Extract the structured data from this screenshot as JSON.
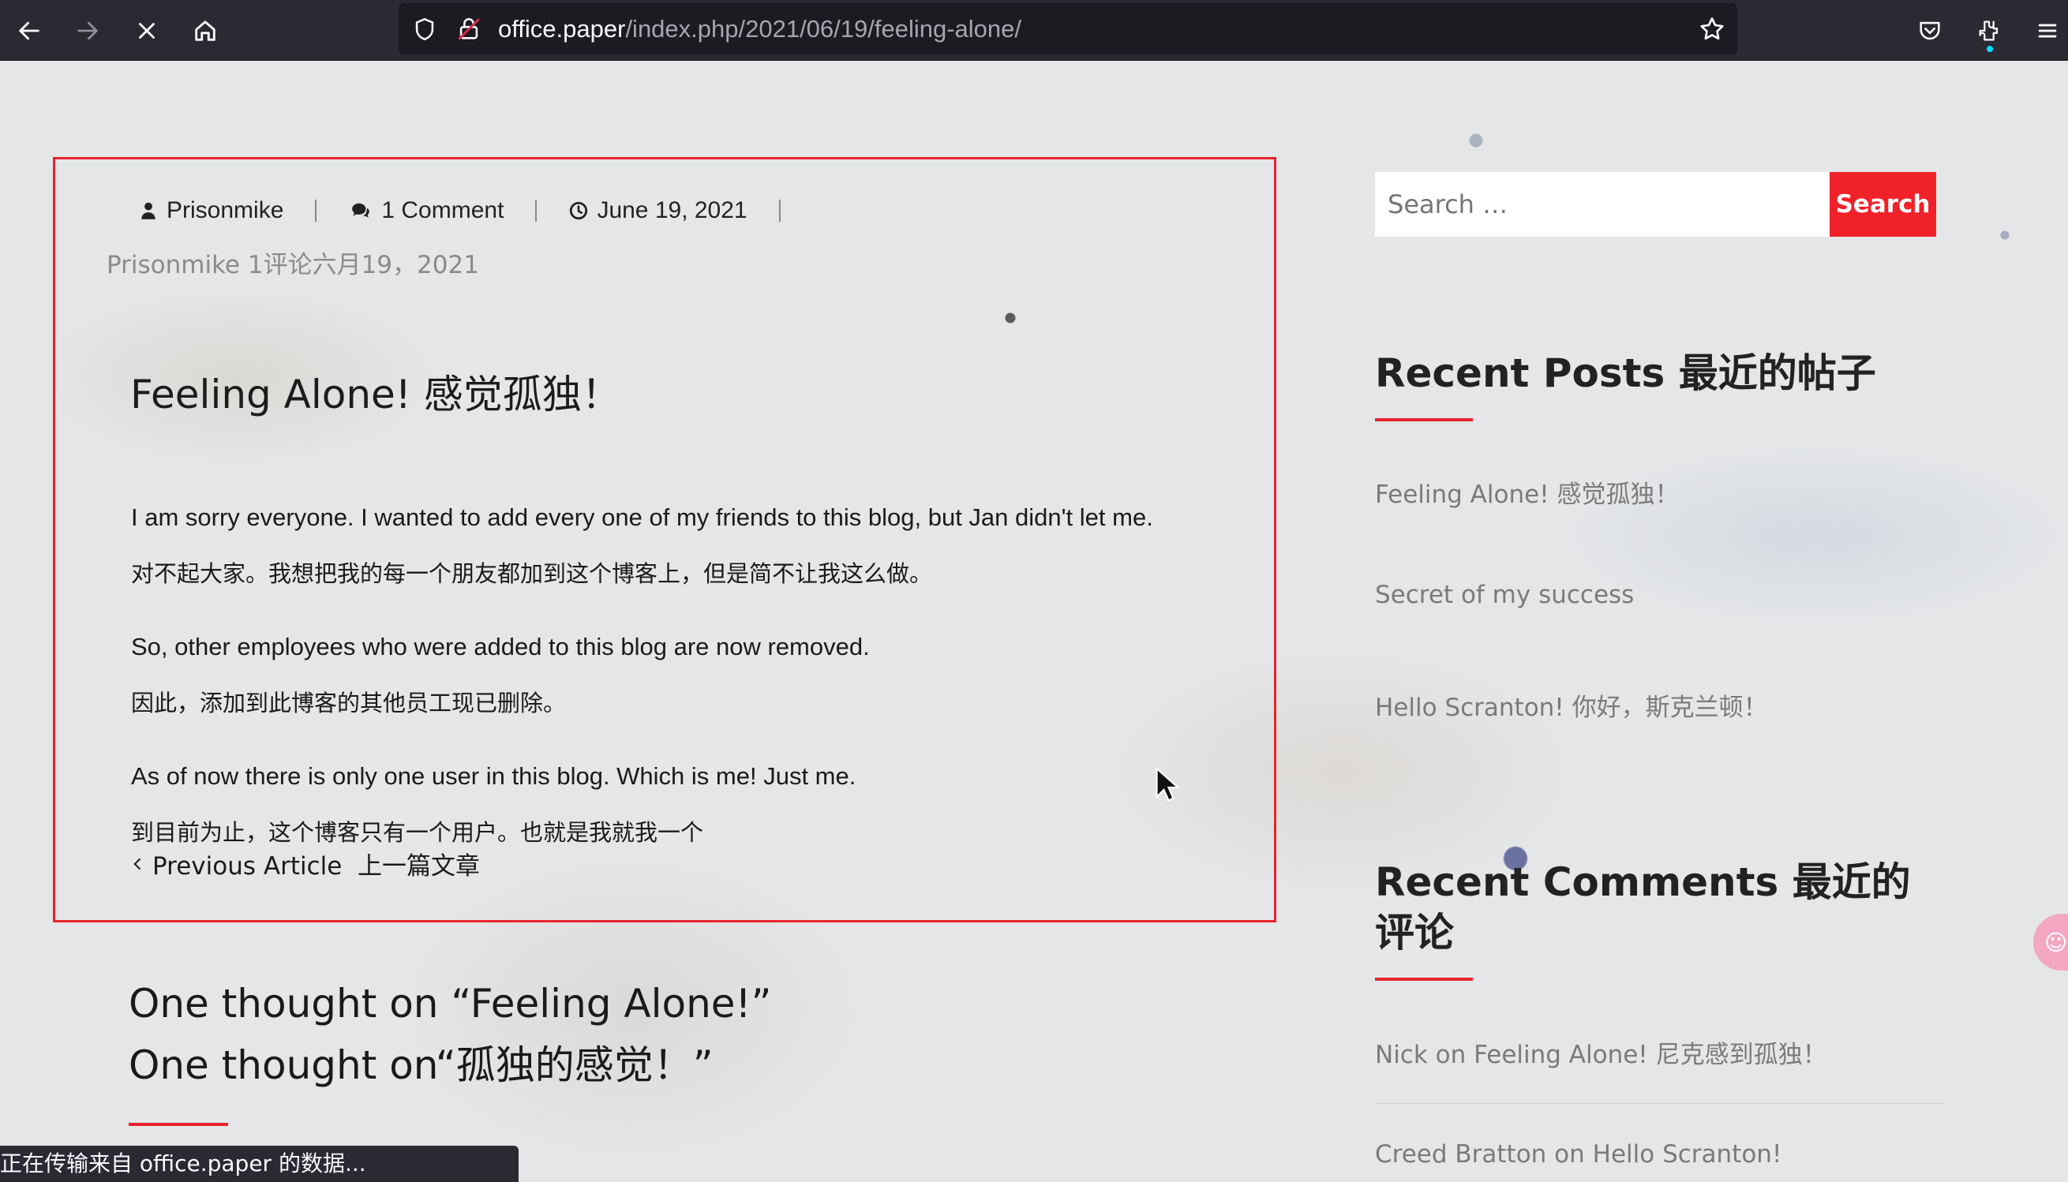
{
  "browser": {
    "url_host": "office.paper",
    "url_path": "/index.php/2021/06/19/feeling-alone/",
    "status_text": "正在传输来自 office.paper 的数据..."
  },
  "article": {
    "meta": {
      "author": "Prisonmike",
      "comments": "1 Comment",
      "date": "June 19, 2021"
    },
    "meta_translation": "Prisonmike 1评论六月19，2021",
    "title": "Feeling Alone! 感觉孤独！",
    "paragraphs": [
      "I am sorry everyone. I wanted to add every one of my friends to this blog, but Jan didn't let me.",
      "对不起大家。我想把我的每一个朋友都加到这个博客上，但是简不让我这么做。",
      "So, other employees who were added to this blog are now removed.",
      "因此，添加到此博客的其他员工现已删除。",
      "As of now there is only one user in this blog. Which is me! Just me.",
      "到目前为止，这个博客只有一个用户。也就是我就我一个"
    ],
    "prev_article_label": "Previous Article  上一篇文章"
  },
  "comments_section": {
    "title_line1": "One thought on “Feeling Alone!”",
    "title_line2": "One thought on“孤独的感觉！”"
  },
  "sidebar": {
    "search": {
      "placeholder": "Search …",
      "button_label": "Search"
    },
    "recent_posts": {
      "title": "Recent Posts 最近的帖子",
      "items": [
        "Feeling Alone!  感觉孤独！",
        "Secret of my success",
        "Hello Scranton!  你好，斯克兰顿！"
      ]
    },
    "recent_comments": {
      "title": "Recent Comments 最近的评论",
      "items": [
        "Nick on Feeling Alone! 尼克感到孤独！",
        "Creed Bratton on Hello Scranton!"
      ]
    }
  },
  "colors": {
    "accent_red": "#e8242c",
    "toolbar_bg": "#2b2a33"
  },
  "icons": [
    "back-arrow-icon",
    "forward-arrow-icon",
    "stop-icon",
    "home-icon",
    "shield-icon",
    "lock-icon",
    "star-icon",
    "pocket-icon",
    "extensions-icon",
    "menu-icon",
    "user-icon",
    "comment-icon",
    "clock-icon",
    "chevron-left-icon"
  ]
}
